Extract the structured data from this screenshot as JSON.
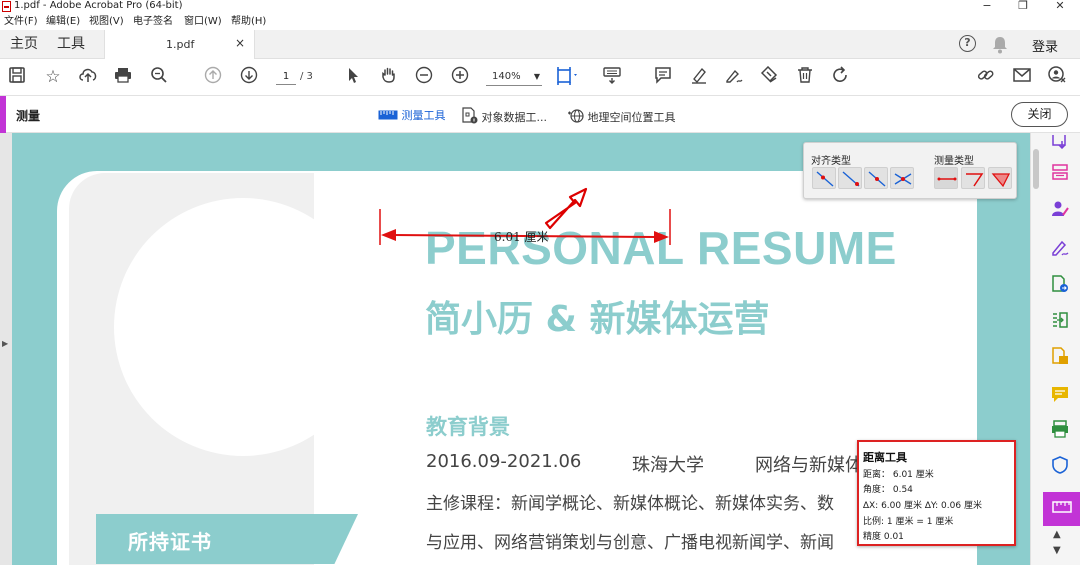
{
  "window": {
    "title": "1.pdf - Adobe Acrobat Pro (64-bit)",
    "controls": {
      "minimize": "−",
      "restore": "❐",
      "close": "✕"
    }
  },
  "menu": [
    "文件(F)",
    "编辑(E)",
    "视图(V)",
    "电子签名",
    "窗口(W)",
    "帮助(H)"
  ],
  "tabs": {
    "home": "主页",
    "tools": "工具",
    "document": "1.pdf",
    "close": "×"
  },
  "header": {
    "help": "?",
    "login": "登录"
  },
  "toolbar": {
    "page_current": "1",
    "page_total": "/ 3",
    "zoom": "140%",
    "icons": [
      "save-icon",
      "star-icon",
      "upload-icon",
      "print-icon",
      "search-icon",
      "page-up-icon",
      "page-down-icon",
      "pointer-icon",
      "hand-icon",
      "zoom-out-icon",
      "zoom-in-icon",
      "fit-page-icon",
      "keyboard-icon",
      "comment-icon",
      "highlight-icon",
      "sign-icon",
      "stamp-icon",
      "delete-icon",
      "rotate-icon",
      "link-icon",
      "mail-icon",
      "user-icon"
    ]
  },
  "measure_bar": {
    "label": "测量",
    "tools": [
      {
        "label": "测量工具",
        "active": true
      },
      {
        "label": "对象数据工...",
        "active": false
      },
      {
        "label": "地理空间位置工具",
        "active": false
      }
    ],
    "close": "关闭"
  },
  "snap_panel": {
    "snap_title": "对齐类型",
    "measure_title": "测量类型"
  },
  "measurement": {
    "label": "6.01 厘米"
  },
  "document": {
    "title": "PERSONAL RESUME",
    "subtitle": "简小历  &  新媒体运营",
    "section_edu": "教育背景",
    "edu_date": "2016.09-2021.06",
    "edu_school": "珠海大学",
    "edu_major": "网络与新媒体",
    "course_line1": "主修课程：新闻学概论、新媒体概论、新媒体实务、数",
    "course_line2": "与应用、网络营销策划与创意、广播电视新闻学、新闻",
    "cert_title": "所持证书"
  },
  "distance_tool": {
    "title": "距离工具",
    "distance": "距离：  6.01 厘米",
    "angle": " 角度：  0.54",
    "delta": "∆X:   6.00 厘米   ∆Y:   0.06 厘米",
    "scale": "比例:   1 厘米 = 1 厘米",
    "precision": "精度     0.01"
  },
  "colors": {
    "accent": "#c234d6",
    "teal": "#8ccdcd",
    "measure_red": "#e01010",
    "active_blue": "#1a62d6"
  }
}
